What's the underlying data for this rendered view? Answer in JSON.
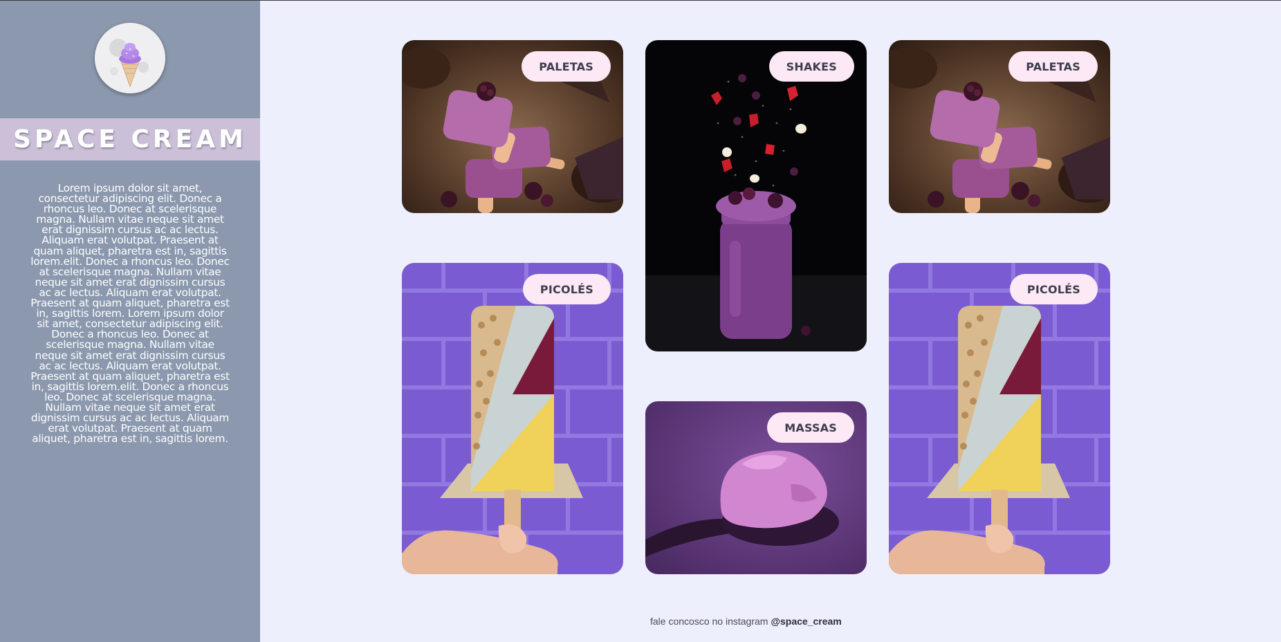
{
  "sidebar": {
    "logo_icon": "ice-cream-cone-icon",
    "brand": "SPACE CREAM",
    "description": "Lorem ipsum dolor sit amet, consectetur adipiscing elit. Donec a rhoncus leo. Donec at scelerisque magna. Nullam vitae neque sit amet erat dignissim cursus ac ac lectus. Aliquam erat volutpat. Praesent at quam aliquet, pharetra est in, sagittis lorem.elit. Donec a rhoncus leo. Donec at scelerisque magna. Nullam vitae neque sit amet erat dignissim cursus ac ac lectus. Aliquam erat volutpat. Praesent at quam aliquet, pharetra est in, sagittis lorem. Lorem ipsum dolor sit amet, consectetur adipiscing elit. Donec a rhoncus leo. Donec at scelerisque magna. Nullam vitae neque sit amet erat dignissim cursus ac ac lectus. Aliquam erat volutpat. Praesent at quam aliquet, pharetra est in, sagittis lorem.elit. Donec a rhoncus leo. Donec at scelerisque magna. Nullam vitae neque sit amet erat dignissim cursus ac ac lectus. Aliquam erat volutpat. Praesent at quam aliquet, pharetra est in, sagittis lorem."
  },
  "cards": [
    {
      "label": "PALETAS",
      "image": "stacked-purple-paletas-photo"
    },
    {
      "label": "SHAKES",
      "image": "berry-shake-jar-photo"
    },
    {
      "label": "PALETAS",
      "image": "stacked-purple-paletas-photo"
    },
    {
      "label": "PICOLÉS",
      "image": "popsicle-in-hand-photo"
    },
    {
      "label": "MASSAS",
      "image": "ice-cream-scoop-photo"
    },
    {
      "label": "PICOLÉS",
      "image": "popsicle-in-hand-photo"
    }
  ],
  "footer": {
    "text": "fale concosco no instagram ",
    "handle": "@space_cream"
  },
  "colors": {
    "page_bg": "#eeeffd",
    "sidebar_bg": "#8b98ae",
    "brand_band": "#cbc0d8",
    "tag_bg": "#fde9f5",
    "tag_text": "#3d3d4e"
  }
}
